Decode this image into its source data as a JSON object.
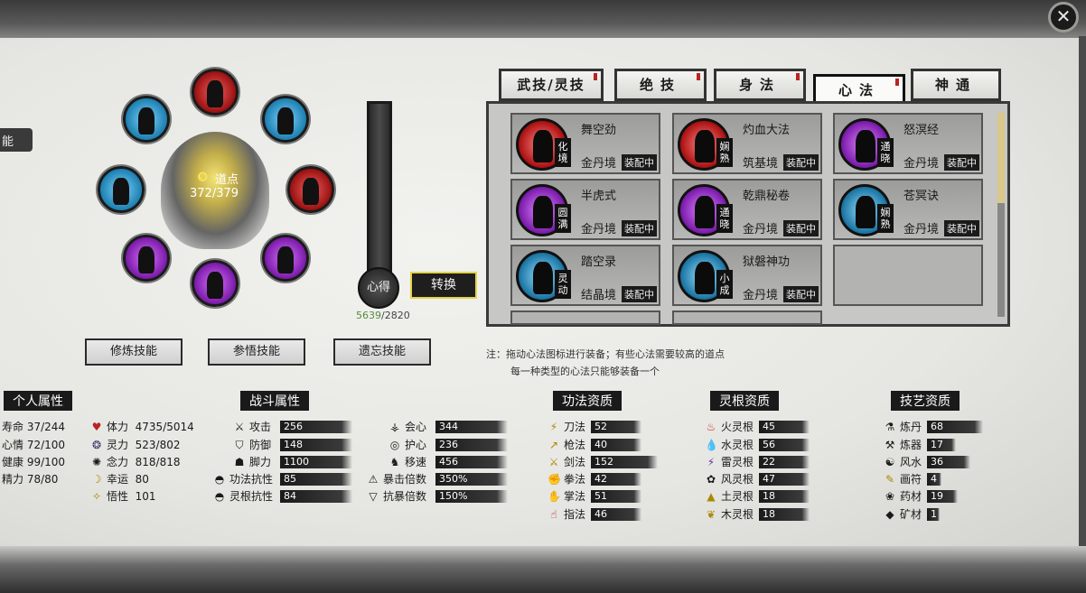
{
  "left_tab": "能",
  "wheel": {
    "points_label": "道点",
    "points_value": "372/379"
  },
  "xinde": {
    "label": "心得",
    "current": "5639",
    "max": "/2820",
    "convert_label": "转换"
  },
  "actions": {
    "train": "修炼技能",
    "comprehend": "参悟技能",
    "forget": "遗忘技能"
  },
  "tabs": [
    {
      "label": "武技/灵技"
    },
    {
      "label": "绝技"
    },
    {
      "label": "身法"
    },
    {
      "label": "心法"
    },
    {
      "label": "神通"
    }
  ],
  "cards": [
    {
      "name": "舞空劲",
      "grade": "金丹境",
      "realm": "化境",
      "equip": "装配中",
      "color": "red"
    },
    {
      "name": "灼血大法",
      "grade": "筑基境",
      "realm": "娴熟",
      "equip": "装配中",
      "color": "red"
    },
    {
      "name": "怒溟经",
      "grade": "金丹境",
      "realm": "通晓",
      "equip": "装配中",
      "color": "purple"
    },
    {
      "name": "半虎式",
      "grade": "金丹境",
      "realm": "圆满",
      "equip": "装配中",
      "color": "purple"
    },
    {
      "name": "乾鼎秘卷",
      "grade": "金丹境",
      "realm": "通晓",
      "equip": "装配中",
      "color": "purple"
    },
    {
      "name": "苍冥诀",
      "grade": "金丹境",
      "realm": "娴熟",
      "equip": "装配中",
      "color": "blue"
    },
    {
      "name": "踏空录",
      "grade": "结晶境",
      "realm": "灵动",
      "equip": "装配中",
      "color": "blue"
    },
    {
      "name": "狱磐神功",
      "grade": "金丹境",
      "realm": "小成",
      "equip": "装配中",
      "color": "blue"
    }
  ],
  "notes": {
    "line1": "注：拖动心法图标进行装备；有些心法需要较高的道点",
    "line2": "每一种类型的心法只能够装备一个"
  },
  "personal": {
    "title": "个人属性",
    "left": [
      {
        "label": "寿命",
        "value": "37/244"
      },
      {
        "label": "心情",
        "value": "72/100"
      },
      {
        "label": "健康",
        "value": "99/100"
      },
      {
        "label": "精力",
        "value": "78/80"
      }
    ],
    "right": [
      {
        "label": "体力",
        "value": "4735/5014",
        "icon": "♥"
      },
      {
        "label": "灵力",
        "value": "523/802",
        "icon": "❂"
      },
      {
        "label": "念力",
        "value": "818/818",
        "icon": "✺"
      },
      {
        "label": "幸运",
        "value": "80",
        "icon": "☽"
      },
      {
        "label": "悟性",
        "value": "101",
        "icon": "✧"
      }
    ]
  },
  "combat": {
    "title": "战斗属性",
    "left": [
      {
        "label": "攻击",
        "value": "256",
        "icon": "⚔"
      },
      {
        "label": "防御",
        "value": "148",
        "icon": "⛉"
      },
      {
        "label": "脚力",
        "value": "1100",
        "icon": "☗"
      },
      {
        "label": "功法抗性",
        "value": "85",
        "icon": "◓"
      },
      {
        "label": "灵根抗性",
        "value": "84",
        "icon": "◓"
      }
    ],
    "right": [
      {
        "label": "会心",
        "value": "344",
        "icon": "⚶"
      },
      {
        "label": "护心",
        "value": "236",
        "icon": "◎"
      },
      {
        "label": "移速",
        "value": "456",
        "icon": "♞"
      },
      {
        "label": "暴击倍数",
        "value": "350%",
        "icon": "⚠"
      },
      {
        "label": "抗暴倍数",
        "value": "150%",
        "icon": "▽"
      }
    ]
  },
  "martial": {
    "title": "功法资质",
    "rows": [
      {
        "label": "刀法",
        "value": "52",
        "icon": "⚡"
      },
      {
        "label": "枪法",
        "value": "40",
        "icon": "↗"
      },
      {
        "label": "剑法",
        "value": "152",
        "icon": "⚔"
      },
      {
        "label": "拳法",
        "value": "42",
        "icon": "✊"
      },
      {
        "label": "掌法",
        "value": "51",
        "icon": "✋"
      },
      {
        "label": "指法",
        "value": "46",
        "icon": "☝"
      }
    ]
  },
  "root": {
    "title": "灵根资质",
    "rows": [
      {
        "label": "火灵根",
        "value": "45",
        "icon": "♨"
      },
      {
        "label": "水灵根",
        "value": "56",
        "icon": "💧"
      },
      {
        "label": "雷灵根",
        "value": "22",
        "icon": "⚡"
      },
      {
        "label": "风灵根",
        "value": "47",
        "icon": "✿"
      },
      {
        "label": "土灵根",
        "value": "18",
        "icon": "▲"
      },
      {
        "label": "木灵根",
        "value": "18",
        "icon": "❦"
      }
    ]
  },
  "craft": {
    "title": "技艺资质",
    "rows": [
      {
        "label": "炼丹",
        "value": "68",
        "icon": "⚗"
      },
      {
        "label": "炼器",
        "value": "17",
        "icon": "⚒"
      },
      {
        "label": "风水",
        "value": "36",
        "icon": "☯"
      },
      {
        "label": "画符",
        "value": "4",
        "icon": "✎"
      },
      {
        "label": "药材",
        "value": "19",
        "icon": "❀"
      },
      {
        "label": "矿材",
        "value": "1",
        "icon": "◆"
      }
    ]
  }
}
